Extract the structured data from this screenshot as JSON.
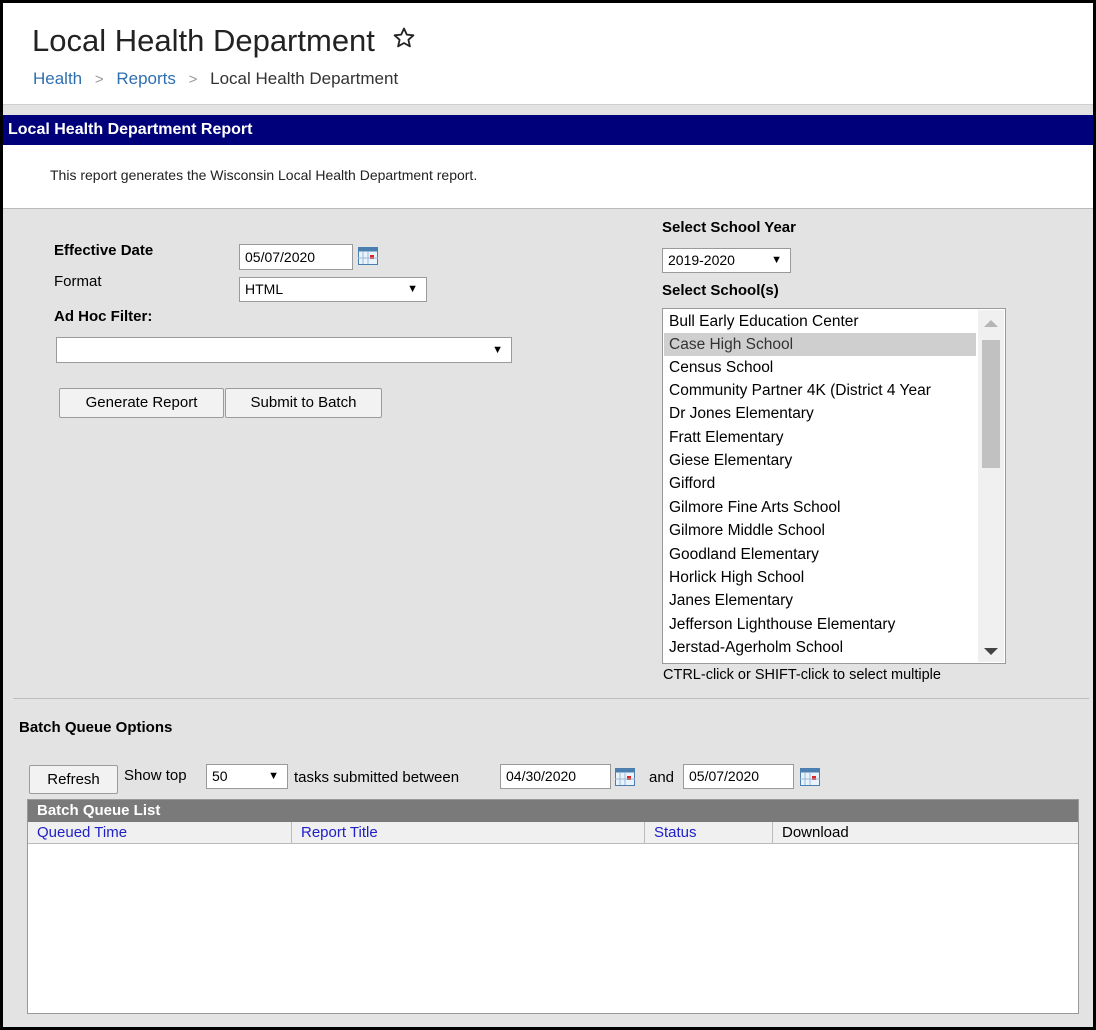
{
  "header": {
    "title": "Local Health Department",
    "breadcrumb": [
      "Health",
      "Reports",
      "Local Health Department"
    ]
  },
  "report": {
    "bar_title": "Local Health Department Report",
    "description": "This report generates the Wisconsin Local Health Department report."
  },
  "form": {
    "effective_date_label": "Effective Date",
    "effective_date_value": "05/07/2020",
    "format_label": "Format",
    "format_value": "HTML",
    "adhoc_label": "Ad Hoc Filter:",
    "adhoc_value": "",
    "generate_label": "Generate Report",
    "submit_batch_label": "Submit to Batch"
  },
  "schools": {
    "year_label": "Select School Year",
    "year_value": "2019-2020",
    "list_label": "Select School(s)",
    "items": [
      "Bull Early Education Center",
      "Case High School",
      "Census School",
      "Community Partner 4K (District 4 Year",
      "Dr Jones Elementary",
      "Fratt Elementary",
      "Giese Elementary",
      "Gifford",
      "Gilmore Fine Arts School",
      "Gilmore Middle School",
      "Goodland Elementary",
      "Horlick High School",
      "Janes Elementary",
      "Jefferson Lighthouse Elementary",
      "Jerstad-Agerholm School"
    ],
    "selected_item": "Case High School",
    "hint": "CTRL-click or SHIFT-click to select multiple"
  },
  "batch": {
    "section_label": "Batch Queue Options",
    "refresh_label": "Refresh",
    "show_top_label": "Show top",
    "show_top_value": "50",
    "between_label": "tasks submitted between",
    "start_date": "04/30/2020",
    "and_label": "and",
    "end_date": "05/07/2020",
    "list_title": "Batch Queue List",
    "columns": [
      "Queued Time",
      "Report Title",
      "Status",
      "Download"
    ]
  },
  "colors": {
    "title_bar": "#00007a",
    "link": "#2f6fb0",
    "column_link": "#2020c8",
    "selected_row": "#cfcfcf"
  }
}
